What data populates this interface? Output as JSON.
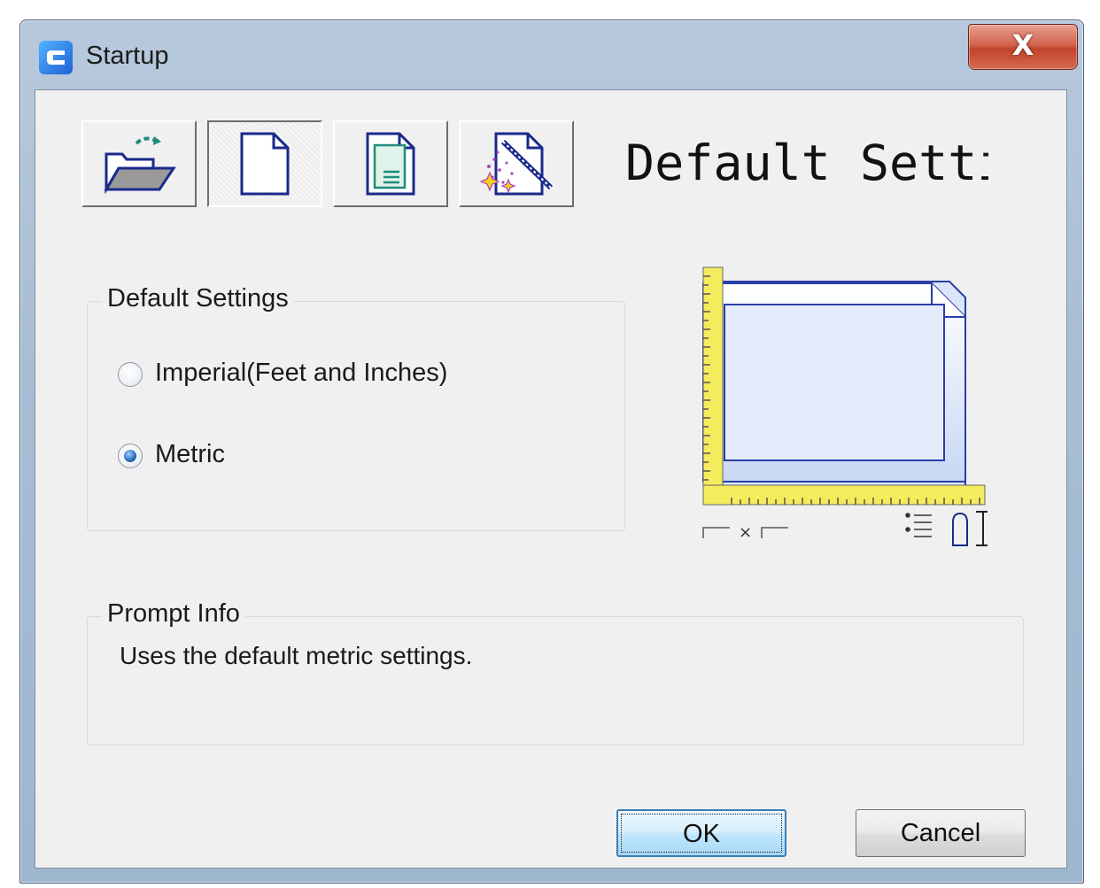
{
  "window": {
    "title": "Startup",
    "close_label": "X"
  },
  "toolbar": {
    "buttons": [
      {
        "icon": "open-drawing-icon"
      },
      {
        "icon": "default-settings-icon",
        "selected": true
      },
      {
        "icon": "use-template-icon"
      },
      {
        "icon": "wizard-icon"
      }
    ]
  },
  "header": {
    "title": "Default Settin"
  },
  "settings_group": {
    "label": "Default Settings",
    "options": [
      {
        "label": "Imperial(Feet and Inches)",
        "selected": false
      },
      {
        "label": "Metric",
        "selected": true
      }
    ]
  },
  "preview": {
    "size_symbol": "×"
  },
  "prompt_group": {
    "label": "Prompt Info",
    "text": "Uses the default metric settings."
  },
  "buttons": {
    "ok": "OK",
    "cancel": "Cancel"
  },
  "colors": {
    "close_button": "#c9492e",
    "default_button": "#3c7fb1",
    "ruler": "#f4ec5c",
    "paper_outline": "#2a3fa6"
  }
}
